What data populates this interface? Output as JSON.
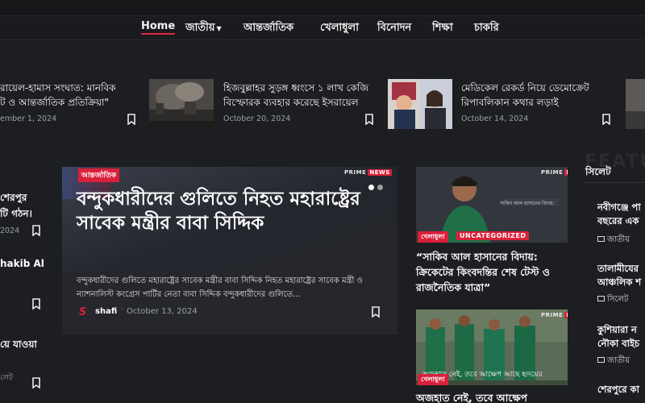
{
  "nav": {
    "items": [
      {
        "label": "Home",
        "active": true
      },
      {
        "label": "জাতীয়",
        "has_dropdown": true
      },
      {
        "label": "আন্তর্জাতিক"
      },
      {
        "label": "খেলাধুলা"
      },
      {
        "label": "বিনোদন"
      },
      {
        "label": "শিক্ষা"
      },
      {
        "label": "চাকরি"
      }
    ]
  },
  "strip": {
    "items": [
      {
        "title_line1": "রায়েল-হামাস সংঘাত: মানবিক",
        "title_line2": "ট ও আন্তর্জাতিক প্রতিক্রিয়া\"",
        "date": "ember 1, 2024"
      },
      {
        "title_line1": "হিজবুল্লাহর সুড়ঙ্গ ধ্বংসে ১ লাখ কেজি",
        "title_line2": "বিস্ফোরক ব্যবহার করেছে ইসরায়েল",
        "date": "October 20, 2024"
      },
      {
        "title_line1": "মেডিকেল রেকর্ড নিয়ে ডেমোক্রেট",
        "title_line2": "রিপাবলিকান কথার লড়াই",
        "date": "October 14, 2024"
      }
    ]
  },
  "left_col": {
    "items": [
      {
        "line1": "শেরপুর",
        "line2": "টি গঠন।",
        "date": "2024"
      },
      {
        "line1": "hakib Al",
        "line2": "",
        "date": ""
      },
      {
        "line1": "য়ে যাওয়া",
        "line2": "",
        "date": "লেট"
      }
    ]
  },
  "hero": {
    "category": "আন্তর্জাতিক",
    "title": "বন্দুকধারীদের গুলিতে নিহত মহারাষ্ট্রের সাবেক মন্ত্রীর বাবা সিদ্দিক",
    "excerpt": "বন্দুকধারীদের গুলিতে মহারাষ্ট্রের সাবেক মন্ত্রীর বাবা সিদ্দিক নিহত মহারাষ্ট্রের সাবেক মন্ত্রী ও ন্যাশনালিস্ট কংগ্রেস পার্টির নেতা বাবা সিদ্দিক বন্দুকধারীদের গুলিতে...",
    "author": "shafi",
    "date": "October 13, 2024",
    "logo_letter": "S",
    "watermark": "PRIME",
    "watermark_tag": "NEWS"
  },
  "cards": [
    {
      "category": "খেলাধুলা",
      "category2": "UNCATEGORIZED",
      "title": "“সাকিব আল হাসানের বিদায়: ক্রিকেটের কিংবদন্তির শেষ টেস্ট ও রাজনৈতিক যাত্রা”",
      "image_caption": "সাকিব আল হাসানের বিদায়:"
    },
    {
      "category": "খেলাধুলা",
      "title": "অজহাত নেই, তবে আক্ষেপ",
      "image_caption": "অজুহাত নেই, তবে আক্ষেপ আছে হৃদয়ের"
    }
  ],
  "right_col": {
    "section_title": "সিলেট",
    "ghost": "FEATU",
    "items": [
      {
        "line1": "নবীগঞ্জে পা",
        "line2": "বছরের এক",
        "meta": "জাতীয়"
      },
      {
        "line1": "তালামীযের",
        "line2": "আঞ্চলিক শ",
        "meta": "সিলেট"
      },
      {
        "line1": "কুশিয়ারা ন",
        "line2": "নৌকা বাইচ",
        "meta": "জাতীয়"
      },
      {
        "line1": "শেরপুরে কা",
        "line2": "",
        "meta": ""
      }
    ]
  },
  "colors": {
    "accent": "#d9203b",
    "background": "#1d1e22"
  }
}
